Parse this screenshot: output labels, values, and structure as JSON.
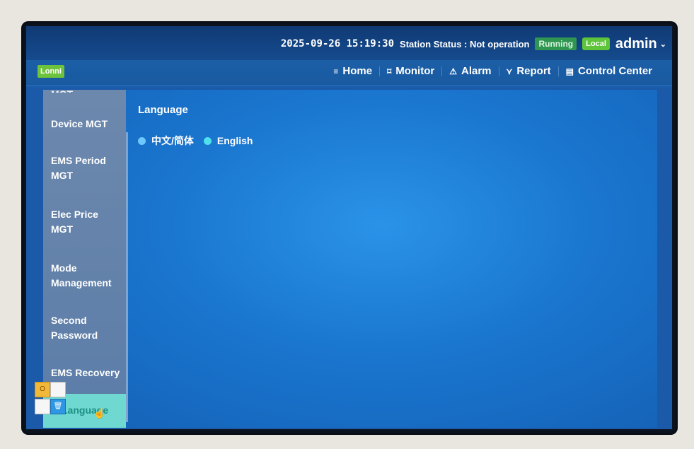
{
  "status_bar": {
    "datetime": "2025-09-26 15:19:30",
    "station_status": "Station Status : Not operation",
    "running_badge": "Running",
    "local_badge": "Local",
    "user": "admin",
    "chevron_glyph": "⌄"
  },
  "nav": {
    "logo": "Lonni",
    "items": [
      {
        "label": "Home",
        "icon": "≡"
      },
      {
        "label": "Monitor",
        "icon": "⌑"
      },
      {
        "label": "Alarm",
        "icon": "⚠"
      },
      {
        "label": "Report",
        "icon": "⋎"
      },
      {
        "label": "Control Center",
        "icon": "▤"
      }
    ]
  },
  "sidebar": {
    "items": [
      {
        "label": "MGT"
      },
      {
        "label": "Device MGT"
      },
      {
        "label": "EMS Period MGT"
      },
      {
        "label": "Elec Price MGT"
      },
      {
        "label": "Mode Management"
      },
      {
        "label": "Second Password"
      },
      {
        "label": "EMS Recovery"
      },
      {
        "label": "Language"
      }
    ]
  },
  "main": {
    "section_title": "Language",
    "options": [
      {
        "label": "中文/简体",
        "selected": false
      },
      {
        "label": "English",
        "selected": true
      }
    ]
  },
  "quick_widget": {
    "cells": [
      "O",
      "",
      "",
      "🗑"
    ]
  }
}
